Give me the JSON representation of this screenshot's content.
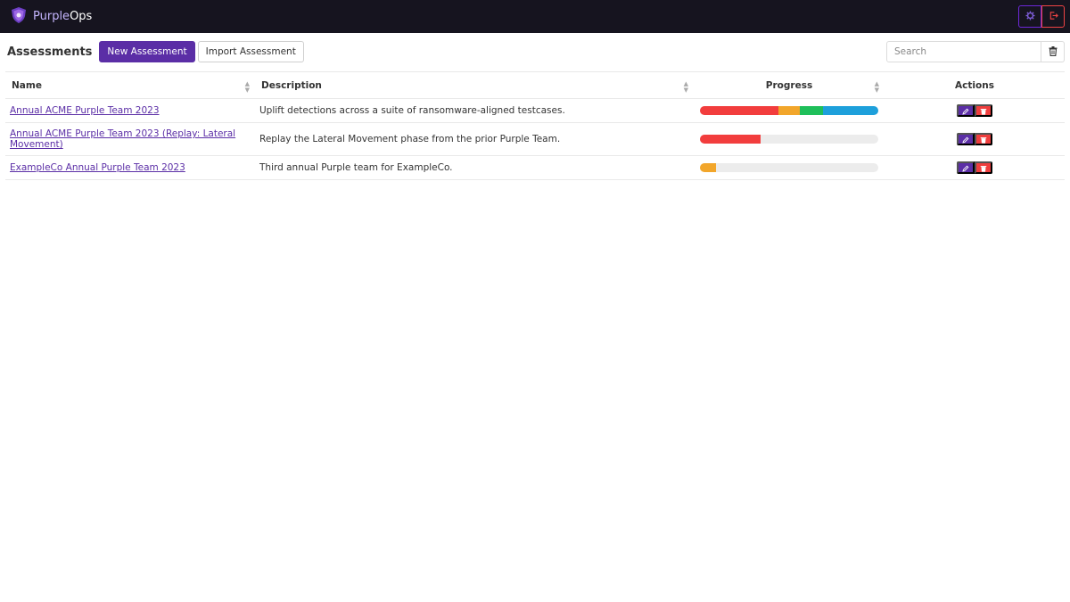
{
  "navbar": {
    "brand_part1": "Purple",
    "brand_part2": "Ops",
    "settings_icon": "gear-icon",
    "logout_icon": "logout-icon"
  },
  "toolbar": {
    "title": "Assessments",
    "new_label": "New Assessment",
    "import_label": "Import Assessment",
    "search_placeholder": "Search"
  },
  "table": {
    "headers": [
      "Name",
      "Description",
      "Progress",
      "Actions"
    ],
    "rows": [
      {
        "name": "Annual ACME Purple Team 2023",
        "description": "Uplift detections across a suite of ransomware-aligned testcases.",
        "progress": [
          {
            "color": "#f23d3d",
            "pct": 44
          },
          {
            "color": "#f2a62b",
            "pct": 12
          },
          {
            "color": "#1fbf5a",
            "pct": 13
          },
          {
            "color": "#1ea0db",
            "pct": 31
          }
        ]
      },
      {
        "name": "Annual ACME Purple Team 2023 (Replay: Lateral Movement)",
        "description": "Replay the Lateral Movement phase from the prior Purple Team.",
        "progress": [
          {
            "color": "#f23d3d",
            "pct": 34
          }
        ]
      },
      {
        "name": "ExampleCo Annual Purple Team 2023",
        "description": "Third annual Purple team for ExampleCo.",
        "progress": [
          {
            "color": "#f2a62b",
            "pct": 9
          }
        ]
      }
    ]
  },
  "colors": {
    "accent": "#5b2ea6",
    "danger": "#ef3e3e",
    "navbar_bg": "#16141f"
  }
}
